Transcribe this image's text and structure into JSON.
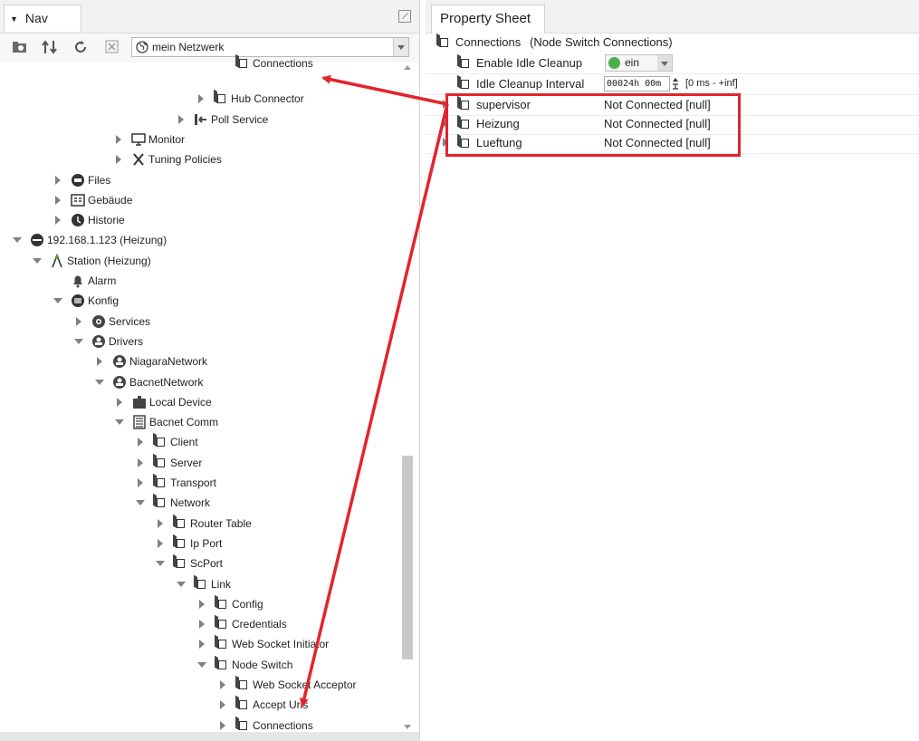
{
  "nav": {
    "title": "Nav",
    "network_selector": "mein Netzwerk",
    "tree": [
      {
        "label": "Connections",
        "icon": "component-icon",
        "state": "leaf"
      },
      {
        "label": "Hub Connector",
        "icon": "component-icon",
        "state": "collapsed"
      },
      {
        "label": "Poll Service",
        "icon": "poll-service-icon",
        "state": "collapsed"
      },
      {
        "label": "Monitor",
        "icon": "monitor-icon",
        "state": "collapsed"
      },
      {
        "label": "Tuning Policies",
        "icon": "tuning-icon",
        "state": "collapsed"
      },
      {
        "label": "Files",
        "icon": "files-icon",
        "state": "collapsed"
      },
      {
        "label": "Gebäude",
        "icon": "building-icon",
        "state": "collapsed"
      },
      {
        "label": "Historie",
        "icon": "history-icon",
        "state": "collapsed"
      },
      {
        "label": "192.168.1.123 (Heizung)",
        "icon": "host-icon",
        "state": "expanded"
      },
      {
        "label": "Station (Heizung)",
        "icon": "station-icon",
        "state": "expanded"
      },
      {
        "label": "Alarm",
        "icon": "bell-icon",
        "state": "leaf"
      },
      {
        "label": "Konfig",
        "icon": "database-icon",
        "state": "expanded"
      },
      {
        "label": "Services",
        "icon": "services-icon",
        "state": "collapsed"
      },
      {
        "label": "Drivers",
        "icon": "drivers-icon",
        "state": "expanded"
      },
      {
        "label": "NiagaraNetwork",
        "icon": "network-icon",
        "state": "collapsed"
      },
      {
        "label": "BacnetNetwork",
        "icon": "network-icon",
        "state": "expanded"
      },
      {
        "label": "Local Device",
        "icon": "device-icon",
        "state": "collapsed"
      },
      {
        "label": "Bacnet Comm",
        "icon": "server-icon",
        "state": "expanded"
      },
      {
        "label": "Client",
        "icon": "component-icon",
        "state": "collapsed"
      },
      {
        "label": "Server",
        "icon": "component-icon",
        "state": "collapsed"
      },
      {
        "label": "Transport",
        "icon": "component-icon",
        "state": "collapsed"
      },
      {
        "label": "Network",
        "icon": "component-icon",
        "state": "expanded"
      },
      {
        "label": "Router Table",
        "icon": "component-icon",
        "state": "collapsed"
      },
      {
        "label": "Ip Port",
        "icon": "component-icon",
        "state": "collapsed"
      },
      {
        "label": "ScPort",
        "icon": "component-icon",
        "state": "expanded"
      },
      {
        "label": "Link",
        "icon": "component-icon",
        "state": "expanded"
      },
      {
        "label": "Config",
        "icon": "component-icon",
        "state": "collapsed"
      },
      {
        "label": "Credentials",
        "icon": "component-icon",
        "state": "collapsed"
      },
      {
        "label": "Web Socket Initiator",
        "icon": "component-icon",
        "state": "collapsed"
      },
      {
        "label": "Node Switch",
        "icon": "component-icon",
        "state": "expanded"
      },
      {
        "label": "Web Socket Acceptor",
        "icon": "component-icon",
        "state": "collapsed"
      },
      {
        "label": "Accept Uris",
        "icon": "component-icon",
        "state": "collapsed"
      },
      {
        "label": "Connections",
        "icon": "component-icon",
        "state": "collapsed"
      }
    ]
  },
  "property_sheet": {
    "tab": "Property Sheet",
    "root": {
      "name": "Connections",
      "type": "(Node Switch Connections)"
    },
    "enable_idle_cleanup": {
      "label": "Enable Idle Cleanup",
      "value": "ein",
      "status_color": "#4caf50"
    },
    "idle_cleanup_interval": {
      "label": "Idle Cleanup Interval",
      "value": "00024h 00m",
      "range": "[0 ms - +inf]"
    },
    "connections": [
      {
        "name": "supervisor",
        "value": "Not Connected [null]"
      },
      {
        "name": "Heizung",
        "value": "Not Connected [null]"
      },
      {
        "name": "Lueftung",
        "value": "Not Connected [null]"
      }
    ]
  },
  "annotation": {
    "color": "#e3242b"
  }
}
